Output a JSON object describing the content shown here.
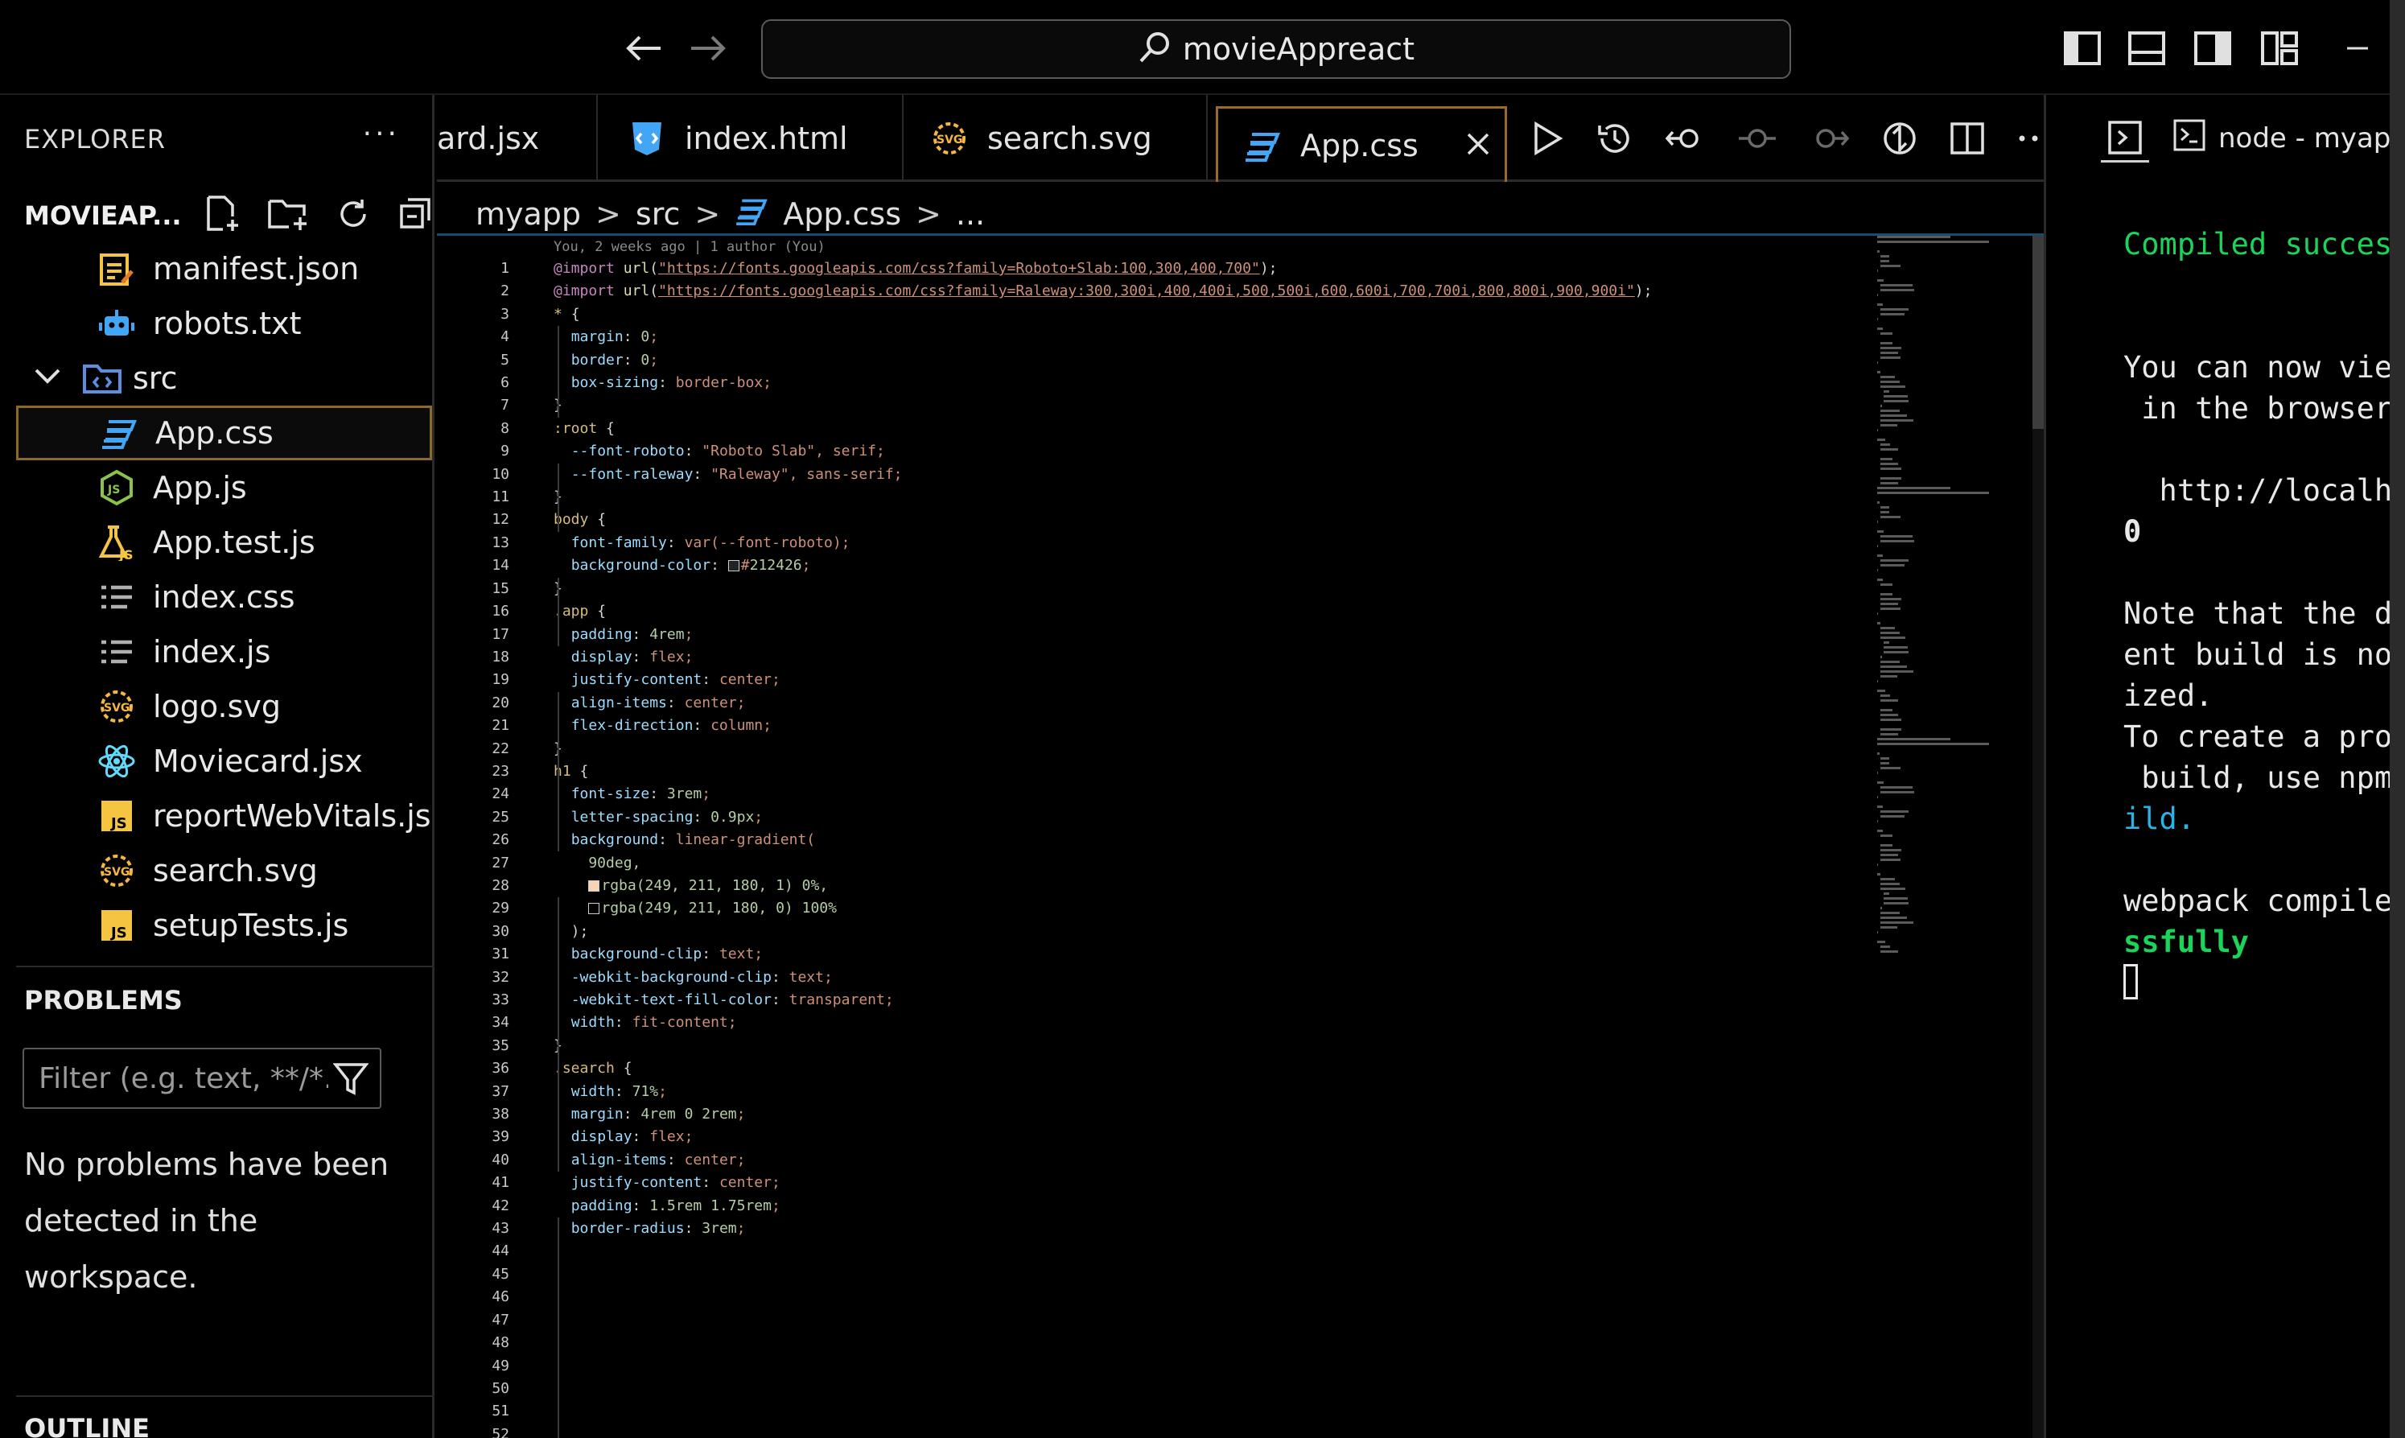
{
  "titlebar": {
    "search_text": "movieAppreact",
    "back_icon": "arrow-left-icon",
    "forward_icon": "arrow-right-icon"
  },
  "sidebar": {
    "header": "EXPLORER",
    "more": "···",
    "project": "MOVIEAP...",
    "files": [
      {
        "name": "manifest.json",
        "icon": "json-file-icon",
        "color": "#f5c542"
      },
      {
        "name": "robots.txt",
        "icon": "robot-file-icon",
        "color": "#42a5f5"
      },
      {
        "name": "src",
        "icon": "folder-src-icon",
        "color": "#5c8fe0",
        "folder": true
      },
      {
        "name": "App.css",
        "icon": "css-file-icon",
        "color": "#42a5f5",
        "selected": true
      },
      {
        "name": "App.js",
        "icon": "nodejs-file-icon",
        "color": "#8bc34a"
      },
      {
        "name": "App.test.js",
        "icon": "test-file-icon",
        "color": "#f5c542"
      },
      {
        "name": "index.css",
        "icon": "list-file-icon",
        "color": "#b0b0b0"
      },
      {
        "name": "index.js",
        "icon": "list-file-icon",
        "color": "#b0b0b0"
      },
      {
        "name": "logo.svg",
        "icon": "svg-file-icon",
        "color": "#f5b642"
      },
      {
        "name": "Moviecard.jsx",
        "icon": "react-file-icon",
        "color": "#61dafb"
      },
      {
        "name": "reportWebVitals.js",
        "icon": "js-file-icon",
        "color": "#f5c542"
      },
      {
        "name": "search.svg",
        "icon": "svg-file-icon",
        "color": "#f5b642"
      },
      {
        "name": "setupTests.js",
        "icon": "js-file-icon",
        "color": "#f5c542"
      }
    ],
    "problems_title": "PROBLEMS",
    "filter_placeholder": "Filter (e.g. text, **/*...",
    "no_problems": "No problems have been detected in the workspace.",
    "outline_title": "OUTLINE"
  },
  "editor": {
    "tabs": [
      {
        "label": "ard.jsx",
        "icon": ""
      },
      {
        "label": "index.html",
        "icon": "html-shield-icon"
      },
      {
        "label": "search.svg",
        "icon": "svg-file-icon"
      },
      {
        "label": "App.css",
        "icon": "css-file-icon",
        "active": true
      }
    ],
    "breadcrumb": [
      "myapp",
      "src",
      "App.css",
      "..."
    ],
    "blame": "You, 2 weeks ago | 1 author (You)",
    "line_count": 52,
    "code_lines": [
      "@import url(\"https://fonts.googleapis.com/css?family=Roboto+Slab:100,300,400,700\");",
      "@import url(\"https://fonts.googleapis.com/css?family=Raleway:300,300i,400,400i,500,500i,600,600i,700,700i,800,800i,900,900i\");",
      "",
      "* {",
      "  margin: 0;",
      "  border: 0;",
      "  box-sizing: border-box;",
      "}",
      "",
      ":root {",
      "  --font-roboto: \"Roboto Slab\", serif;",
      "  --font-raleway: \"Raleway\", sans-serif;",
      "}",
      "",
      "body {",
      "  font-family: var(--font-roboto);",
      "  background-color: □#212426;",
      "}",
      "",
      ".app {",
      "  padding: 4rem;",
      "",
      "  display: flex;",
      "  justify-content: center;",
      "  align-items: center;",
      "  flex-direction: column;",
      "}",
      "",
      "h1 {",
      "  font-size: 3rem;",
      "  letter-spacing: 0.9px;",
      "  background: linear-gradient(",
      "    90deg,",
      "    ■rgba(249, 211, 180, 1) 0%,",
      "    □rgba(249, 211, 180, 0) 100%",
      "  );",
      "  background-clip: text;",
      "  -webkit-background-clip: text;",
      "  -webkit-text-fill-color: transparent;",
      "  width: fit-content;",
      "}",
      "",
      ".search {",
      "  width: 71%;",
      "  margin: 4rem 0 2rem;",
      "",
      "  display: flex;",
      "  align-items: center;",
      "  justify-content: center;",
      "",
      "  padding: 1.5rem 1.75rem;",
      "  border-radius: 3rem;"
    ]
  },
  "terminal": {
    "title": "node - myapp",
    "lines": [
      "Compiled succes",
      "",
      "",
      "You can now vie",
      " in the browser",
      "",
      "  http://localh",
      "0",
      "",
      "Note that the d",
      "ent build is no",
      "ized.",
      "To create a pro",
      " build, use npm",
      "ild.",
      "",
      "webpack compile",
      "ssfully"
    ]
  },
  "colors": {
    "accent": "#9a6a2a",
    "terminal_green": "#1bd45a",
    "terminal_cyan": "#2ab3e8"
  }
}
